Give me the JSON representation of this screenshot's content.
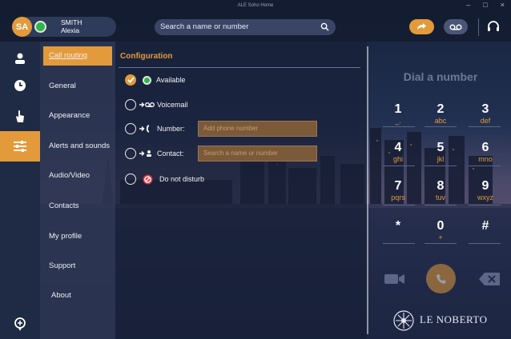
{
  "window": {
    "title": "ALE Soho Home",
    "controls": {
      "minimize": "–",
      "maximize": "□",
      "close": "×"
    }
  },
  "user": {
    "initials": "SA",
    "last_name": "SMITH",
    "first_name": "Alexia",
    "presence": "available",
    "presence_color": "#2fb64a"
  },
  "search": {
    "placeholder": "Search a name or number",
    "icon": "search-icon"
  },
  "toolbar": {
    "forward_icon": "call-forward-icon",
    "voicemail_icon": "voicemail-icon",
    "headset_icon": "headset-icon"
  },
  "colors": {
    "accent": "#e39a3b",
    "sidebar": "#1f2a44",
    "menu": "#2c3652"
  },
  "rail": {
    "items": [
      {
        "icon": "contact-icon"
      },
      {
        "icon": "history-clock-icon"
      },
      {
        "icon": "touch-hand-icon"
      },
      {
        "icon": "settings-sliders-icon",
        "active": true
      },
      {
        "icon": "location-pin-icon"
      }
    ]
  },
  "menu": {
    "items": [
      {
        "label": "Call routing",
        "active": true
      },
      {
        "label": "General"
      },
      {
        "label": "Appearance"
      },
      {
        "label": "Alerts and sounds"
      },
      {
        "label": "Audio/Video"
      },
      {
        "label": "Contacts"
      },
      {
        "label": "My profile"
      },
      {
        "label": "Support"
      },
      {
        "label": "About"
      }
    ]
  },
  "configuration": {
    "title": "Configuration",
    "options": {
      "available": "Available",
      "voicemail": "Voicemail",
      "number": "Number:",
      "number_placeholder": "Add phone number",
      "contact": "Contact:",
      "contact_placeholder": "Search a name or number",
      "dnd": "Do not disturb"
    },
    "selected": "available"
  },
  "dialpad": {
    "title": "Dial a number",
    "keys": [
      {
        "n": "1",
        "l": "_."
      },
      {
        "n": "2",
        "l": "abc"
      },
      {
        "n": "3",
        "l": "def"
      },
      {
        "n": "4",
        "l": "ghi"
      },
      {
        "n": "5",
        "l": "jkl"
      },
      {
        "n": "6",
        "l": "mno"
      },
      {
        "n": "7",
        "l": "pqrs"
      },
      {
        "n": "8",
        "l": "tuv"
      },
      {
        "n": "9",
        "l": "wxyz"
      },
      {
        "n": "*",
        "l": ""
      },
      {
        "n": "0",
        "l": "+"
      },
      {
        "n": "#",
        "l": ""
      }
    ]
  },
  "brand": {
    "name": "LE NOBERTO"
  }
}
